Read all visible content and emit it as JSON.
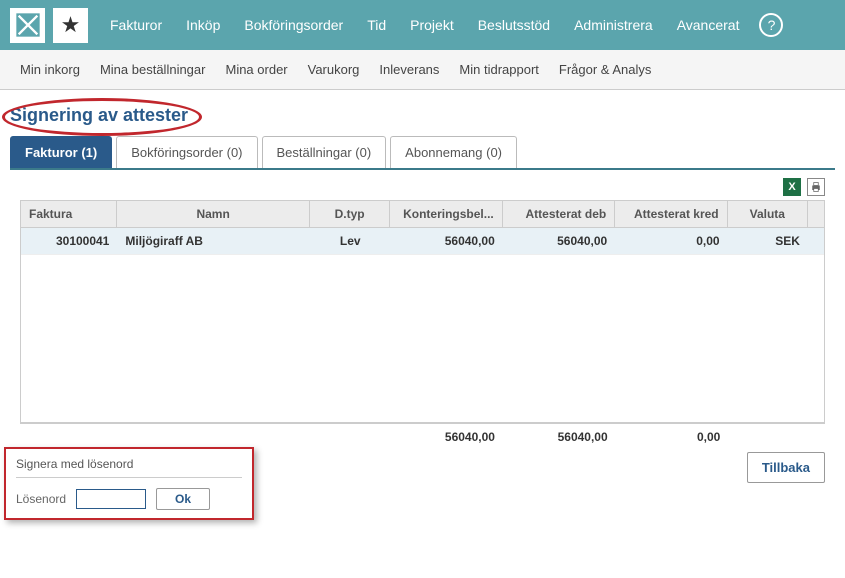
{
  "topnav": {
    "items": [
      "Fakturor",
      "Inköp",
      "Bokföringsorder",
      "Tid",
      "Projekt",
      "Beslutsstöd",
      "Administrera",
      "Avancerat"
    ]
  },
  "subnav": {
    "items": [
      "Min inkorg",
      "Mina beställningar",
      "Mina order",
      "Varukorg",
      "Inleverans",
      "Min tidrapport",
      "Frågor & Analys"
    ]
  },
  "page": {
    "title": "Signering av attester"
  },
  "tabs": [
    {
      "label": "Fakturor (1)",
      "active": true
    },
    {
      "label": "Bokföringsorder (0)",
      "active": false
    },
    {
      "label": "Beställningar (0)",
      "active": false
    },
    {
      "label": "Abonnemang (0)",
      "active": false
    }
  ],
  "table": {
    "headers": {
      "faktura": "Faktura",
      "namn": "Namn",
      "dtyp": "D.typ",
      "konteringsbel": "Konteringsbel...",
      "attesterat_deb": "Attesterat deb",
      "attesterat_kred": "Attesterat kred",
      "valuta": "Valuta"
    },
    "rows": [
      {
        "faktura": "30100041",
        "namn": "Miljögiraff AB",
        "dtyp": "Lev",
        "konteringsbel": "56040,00",
        "attesterat_deb": "56040,00",
        "attesterat_kred": "0,00",
        "valuta": "SEK"
      }
    ],
    "totals": {
      "konteringsbel": "56040,00",
      "attesterat_deb": "56040,00",
      "attesterat_kred": "0,00"
    }
  },
  "buttons": {
    "back": "Tillbaka",
    "ok": "Ok"
  },
  "sign": {
    "title": "Signera med lösenord",
    "label": "Lösenord",
    "value": ""
  }
}
